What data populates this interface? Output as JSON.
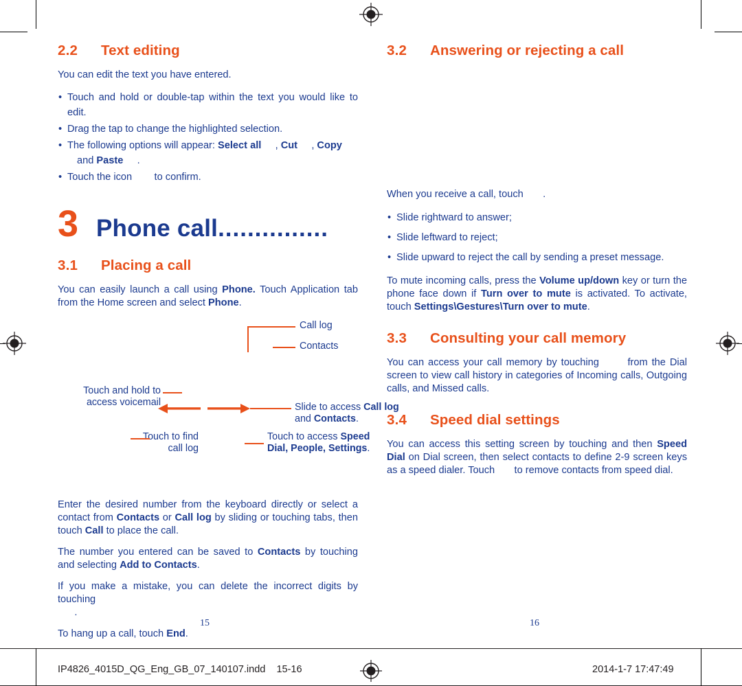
{
  "left_column": {
    "section_2_2": {
      "number": "2.2",
      "title": "Text editing",
      "intro": "You can edit the text you have entered.",
      "bullets": [
        "Touch and hold or double-tap within the text you would like to edit.",
        "Drag the tap to change the highlighted selection.",
        "The following options will appear: Select all , Cut , Copy and Paste .",
        "Touch the icon  to confirm."
      ],
      "bullet3_pre": "The following options will appear: ",
      "bullet3_b1": "Select all",
      "bullet3_sep1": ", ",
      "bullet3_b2": "Cut",
      "bullet3_sep2": ", ",
      "bullet3_b3": "Copy",
      "bullet3_and": "and ",
      "bullet3_b4": "Paste",
      "bullet3_end": ".",
      "bullet4_pre": "Touch the icon ",
      "bullet4_post": " to confirm."
    },
    "chapter": {
      "number": "3",
      "title": "Phone call",
      "dots": "..............."
    },
    "section_3_1": {
      "number": "3.1",
      "title": "Placing a call",
      "para1_a": "You can easily launch a call using ",
      "para1_b1": "Phone.",
      "para1_b": " Touch Application tab from the Home screen and select ",
      "para1_b2": "Phone",
      "para1_c": "."
    },
    "figure": {
      "label_call_log": "Call log",
      "label_contacts": "Contacts",
      "label_voicemail_1": "Touch and hold to",
      "label_voicemail_2": "access voicemail",
      "label_slide_1": "Slide to access ",
      "label_slide_b1": "Call log",
      "label_slide_2": "and ",
      "label_slide_b2": "Contacts",
      "label_slide_3": ".",
      "label_find_1": "Touch to find",
      "label_find_2": "call log",
      "label_touch_access_1": "Touch to access ",
      "label_touch_access_b1": "Speed",
      "label_touch_access_b2": "Dial, People, Settings",
      "label_touch_access_3": "."
    },
    "para_enter_a": "Enter the desired number from the keyboard directly or select a contact from ",
    "para_enter_b1": "Contacts",
    "para_enter_b": " or ",
    "para_enter_b2": "Call log",
    "para_enter_c": " by sliding or touching tabs, then touch ",
    "para_enter_b3": "Call",
    "para_enter_d": " to place the call.",
    "para_saved_a": "The number you entered can be saved to ",
    "para_saved_b1": "Contacts",
    "para_saved_b": " by touching        and selecting ",
    "para_saved_b2": "Add to Contacts",
    "para_saved_c": ".",
    "para_mistake": "If you make a mistake, you can delete the incorrect digits by touching",
    "para_mistake_dot": ".",
    "para_hangup_a": "To hang up a call, touch ",
    "para_hangup_b1": "End",
    "para_hangup_c": ".",
    "page_number": "15"
  },
  "right_column": {
    "section_3_2": {
      "number": "3.2",
      "title": "Answering or rejecting a call",
      "intro_a": "When you receive a call, touch ",
      "intro_b": ".",
      "bullets": [
        "Slide rightward to answer;",
        "Slide leftward to reject;",
        "Slide upward to reject the call by sending a preset message."
      ],
      "para_mute_a": "To mute incoming calls, press the ",
      "para_mute_b1": "Volume up/down",
      "para_mute_b": " key or turn the phone face down if ",
      "para_mute_b2": "Turn over to mute",
      "para_mute_c": " is activated. To activate, touch ",
      "para_mute_b3": "Settings\\Gestures\\Turn over to mute",
      "para_mute_d": "."
    },
    "section_3_3": {
      "number": "3.3",
      "title": "Consulting your call memory",
      "para_a": "You can access your call memory by touching ",
      "para_b": " from the Dial screen to view call history in categories of Incoming calls, Outgoing calls, and Missed calls."
    },
    "section_3_4": {
      "number": "3.4",
      "title": "Speed dial settings",
      "para_a": "You can access this setting screen by touching   and then  ",
      "para_b1": "Speed Dial",
      "para_b": " on Dial screen, then select contacts to define 2-9 screen keys as a speed dialer. Touch ",
      "para_c": " to remove contacts from speed dial."
    },
    "page_number": "16"
  },
  "footer": {
    "filename": "IP4826_4015D_QG_Eng_GB_07_140107.indd",
    "pages": "15-16",
    "timestamp": "2014-1-7   17:47:49"
  },
  "colors": {
    "accent": "#e8501a",
    "body": "#1b3a8f",
    "rule": "#231f20"
  }
}
